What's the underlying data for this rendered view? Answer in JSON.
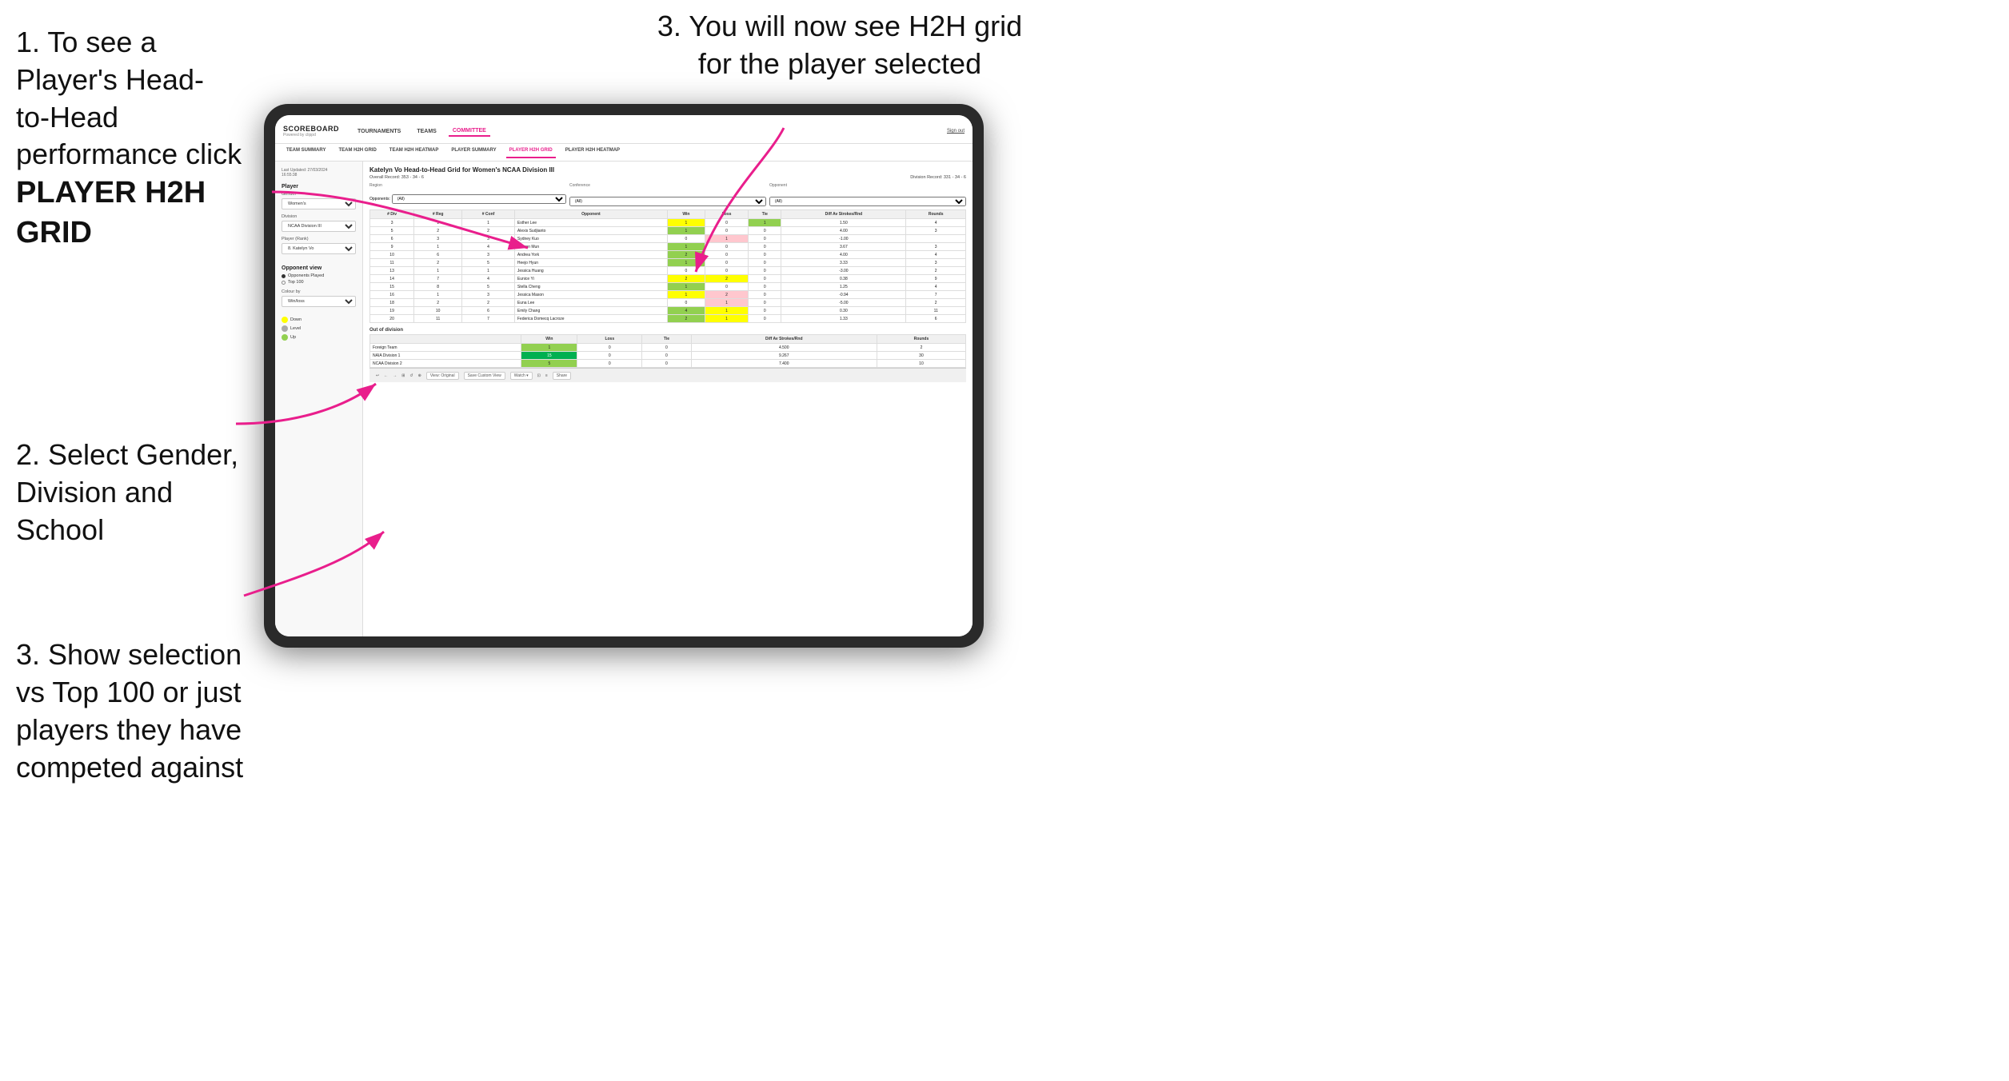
{
  "instructions": {
    "item1_line1": "1. To see a Player's Head-",
    "item1_line2": "to-Head performance click",
    "item1_bold": "PLAYER H2H GRID",
    "item2_line1": "2. Select Gender,",
    "item2_line2": "Division and",
    "item2_line3": "School",
    "item3_left_line1": "3. Show selection",
    "item3_left_line2": "vs Top 100 or just",
    "item3_left_line3": "players they have",
    "item3_left_line4": "competed against",
    "item3_right_line1": "3. You will now see H2H grid",
    "item3_right_line2": "for the player selected"
  },
  "nav": {
    "logo": "SCOREBOARD",
    "logo_sub": "Powered by clippd",
    "items": [
      "TOURNAMENTS",
      "TEAMS",
      "COMMITTEE"
    ],
    "active_item": "COMMITTEE",
    "sign_out": "Sign out"
  },
  "sub_nav": {
    "items": [
      "TEAM SUMMARY",
      "TEAM H2H GRID",
      "TEAM H2H HEATMAP",
      "PLAYER SUMMARY",
      "PLAYER H2H GRID",
      "PLAYER H2H HEATMAP"
    ],
    "active_item": "PLAYER H2H GRID"
  },
  "left_panel": {
    "timestamp": "Last Updated: 27/03/2024",
    "time": "16:55:38",
    "player_label": "Player",
    "gender_label": "Gender",
    "gender_value": "Women's",
    "division_label": "Division",
    "division_value": "NCAA Division III",
    "player_rank_label": "Player (Rank)",
    "player_rank_value": "8. Katelyn Vo",
    "opponent_view_label": "Opponent view",
    "radio1": "Opponents Played",
    "radio2": "Top 100",
    "colour_by_label": "Colour by",
    "colour_by_value": "Win/loss",
    "legend_down": "Down",
    "legend_level": "Level",
    "legend_up": "Up"
  },
  "main": {
    "title": "Katelyn Vo Head-to-Head Grid for Women's NCAA Division III",
    "overall_record_label": "Overall Record:",
    "overall_record_value": "353 - 34 - 6",
    "division_record_label": "Division Record:",
    "division_record_value": "331 - 34 - 6",
    "region_label": "Region",
    "conference_label": "Conference",
    "opponent_label": "Opponent",
    "opponents_label": "Opponents:",
    "opponents_value": "(All)",
    "conf_filter_value": "(All)",
    "opp_filter_value": "(All)",
    "table_headers": [
      "# Div",
      "# Reg",
      "# Conf",
      "Opponent",
      "Win",
      "Loss",
      "Tie",
      "Diff Av Strokes/Rnd",
      "Rounds"
    ],
    "rows": [
      {
        "div": "3",
        "reg": "1",
        "conf": "1",
        "opponent": "Esther Lee",
        "win": "1",
        "loss": "0",
        "tie": "1",
        "diff": "1.50",
        "rounds": "4",
        "win_color": "yellow",
        "loss_color": "white",
        "tie_color": "green"
      },
      {
        "div": "5",
        "reg": "2",
        "conf": "2",
        "opponent": "Alexis Sudjianto",
        "win": "1",
        "loss": "0",
        "tie": "0",
        "diff": "4.00",
        "rounds": "3",
        "win_color": "green",
        "loss_color": "white",
        "tie_color": "white"
      },
      {
        "div": "6",
        "reg": "3",
        "conf": "3",
        "opponent": "Sydney Kuo",
        "win": "0",
        "loss": "1",
        "tie": "0",
        "diff": "-1.00",
        "rounds": "",
        "win_color": "white",
        "loss_color": "red",
        "tie_color": "white"
      },
      {
        "div": "9",
        "reg": "1",
        "conf": "4",
        "opponent": "Sharon Mun",
        "win": "1",
        "loss": "0",
        "tie": "0",
        "diff": "3.67",
        "rounds": "3",
        "win_color": "green",
        "loss_color": "white",
        "tie_color": "white"
      },
      {
        "div": "10",
        "reg": "6",
        "conf": "3",
        "opponent": "Andrea York",
        "win": "2",
        "loss": "0",
        "tie": "0",
        "diff": "4.00",
        "rounds": "4",
        "win_color": "green",
        "loss_color": "white",
        "tie_color": "white"
      },
      {
        "div": "11",
        "reg": "2",
        "conf": "5",
        "opponent": "Heejo Hyun",
        "win": "1",
        "loss": "0",
        "tie": "0",
        "diff": "3.33",
        "rounds": "3",
        "win_color": "green",
        "loss_color": "white",
        "tie_color": "white"
      },
      {
        "div": "13",
        "reg": "1",
        "conf": "1",
        "opponent": "Jessica Huang",
        "win": "0",
        "loss": "0",
        "tie": "0",
        "diff": "-3.00",
        "rounds": "2",
        "win_color": "white",
        "loss_color": "white",
        "tie_color": "white"
      },
      {
        "div": "14",
        "reg": "7",
        "conf": "4",
        "opponent": "Eunice Yi",
        "win": "2",
        "loss": "2",
        "tie": "0",
        "diff": "0.38",
        "rounds": "9",
        "win_color": "yellow",
        "loss_color": "yellow",
        "tie_color": "white"
      },
      {
        "div": "15",
        "reg": "8",
        "conf": "5",
        "opponent": "Stella Cheng",
        "win": "1",
        "loss": "0",
        "tie": "0",
        "diff": "1.25",
        "rounds": "4",
        "win_color": "green",
        "loss_color": "white",
        "tie_color": "white"
      },
      {
        "div": "16",
        "reg": "1",
        "conf": "3",
        "opponent": "Jessica Mason",
        "win": "1",
        "loss": "2",
        "tie": "0",
        "diff": "-0.94",
        "rounds": "7",
        "win_color": "yellow",
        "loss_color": "red",
        "tie_color": "white"
      },
      {
        "div": "18",
        "reg": "2",
        "conf": "2",
        "opponent": "Euna Lee",
        "win": "0",
        "loss": "1",
        "tie": "0",
        "diff": "-5.00",
        "rounds": "2",
        "win_color": "white",
        "loss_color": "red",
        "tie_color": "white"
      },
      {
        "div": "19",
        "reg": "10",
        "conf": "6",
        "opponent": "Emily Chang",
        "win": "4",
        "loss": "1",
        "tie": "0",
        "diff": "0.30",
        "rounds": "11",
        "win_color": "green",
        "loss_color": "yellow",
        "tie_color": "white"
      },
      {
        "div": "20",
        "reg": "11",
        "conf": "7",
        "opponent": "Federica Domecq Lacroze",
        "win": "2",
        "loss": "1",
        "tie": "0",
        "diff": "1.33",
        "rounds": "6",
        "win_color": "green",
        "loss_color": "yellow",
        "tie_color": "white"
      }
    ],
    "out_of_division_label": "Out of division",
    "out_rows": [
      {
        "opponent": "Foreign Team",
        "win": "1",
        "loss": "0",
        "tie": "0",
        "diff": "4.500",
        "rounds": "2",
        "win_color": "green"
      },
      {
        "opponent": "NAIA Division 1",
        "win": "15",
        "loss": "0",
        "tie": "0",
        "diff": "9.267",
        "rounds": "30",
        "win_color": "dark-green"
      },
      {
        "opponent": "NCAA Division 2",
        "win": "5",
        "loss": "0",
        "tie": "0",
        "diff": "7.400",
        "rounds": "10",
        "win_color": "green"
      }
    ],
    "toolbar_items": [
      "↩",
      "←",
      "→",
      "⊞",
      "↺",
      "⊕",
      "⊙",
      "View: Original",
      "Save Custom View",
      "Watch ▾",
      "⊡",
      "≡",
      "Share"
    ]
  }
}
